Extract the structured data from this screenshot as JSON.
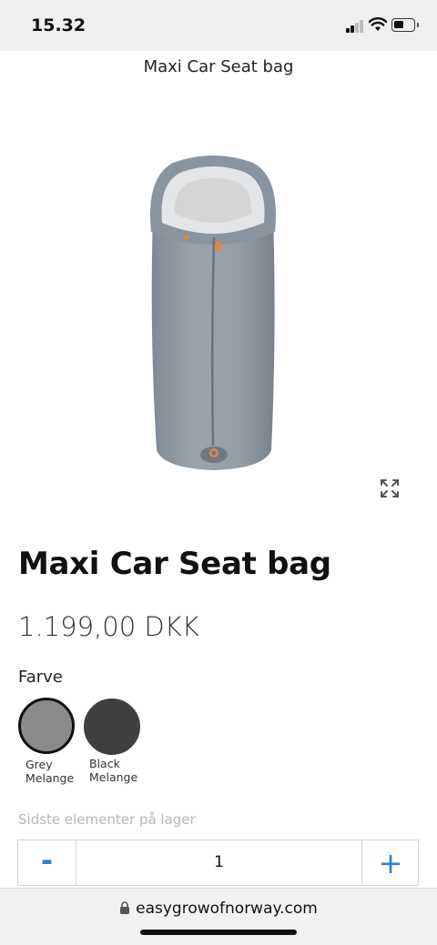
{
  "status_bar": {
    "time": "15.32",
    "icons": [
      "signal-icon",
      "wifi-icon",
      "battery-icon"
    ]
  },
  "header": {
    "title": "Maxi Car Seat bag"
  },
  "product": {
    "image_icon": "car-seat-bag-image",
    "expand_icon": "expand-icon",
    "title": "Maxi Car Seat bag",
    "price": "1.199,00 DKK",
    "color_label": "Farve",
    "colors": [
      {
        "line1": "Grey",
        "line2": "Melange",
        "hex": "#8b8b8b",
        "selected": true
      },
      {
        "line1": "Black",
        "line2": "Melange",
        "hex": "#3f3f3f",
        "selected": false
      }
    ],
    "stock_note": "Sidste elementer på lager",
    "quantity": {
      "minus": "-",
      "value": "1",
      "plus": "+"
    }
  },
  "browser": {
    "url": "easygrowofnorway.com"
  },
  "colors": {
    "accent": "#2a7ed8",
    "muted": "#b5b5b5"
  }
}
